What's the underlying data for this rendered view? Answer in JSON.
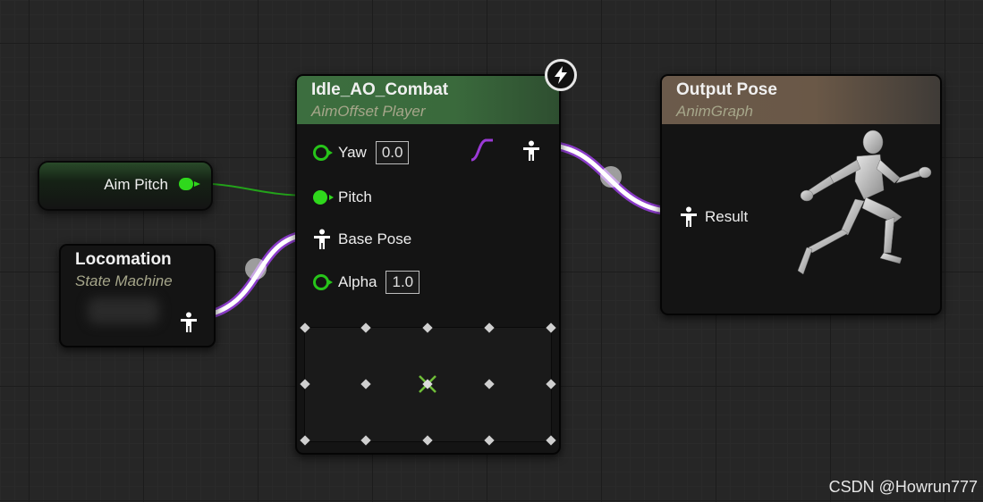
{
  "nodes": {
    "aim_pitch": {
      "label": "Aim Pitch"
    },
    "locomotion": {
      "title": "Locomation",
      "subtitle": "State Machine"
    },
    "aim_offset": {
      "title": "Idle_AO_Combat",
      "subtitle": "AimOffset Player",
      "inputs": {
        "yaw": {
          "label": "Yaw",
          "value": "0.0"
        },
        "pitch": {
          "label": "Pitch"
        },
        "base_pose": {
          "label": "Base Pose"
        },
        "alpha": {
          "label": "Alpha",
          "value": "1.0"
        }
      }
    },
    "output_pose": {
      "title": "Output Pose",
      "subtitle": "AnimGraph",
      "inputs": {
        "result": {
          "label": "Result"
        }
      }
    }
  },
  "colors": {
    "float_pin": "#2fd81c",
    "pose_wire_outline": "#8a3cc8",
    "aim_offset_header": "#3c6e3f",
    "output_pose_header": "#6b5a4b"
  },
  "icons": [
    "pose-pin-icon",
    "lightning-bolt-icon",
    "curve-icon",
    "mannequin-icon"
  ],
  "watermark": "CSDN @Howrun777"
}
